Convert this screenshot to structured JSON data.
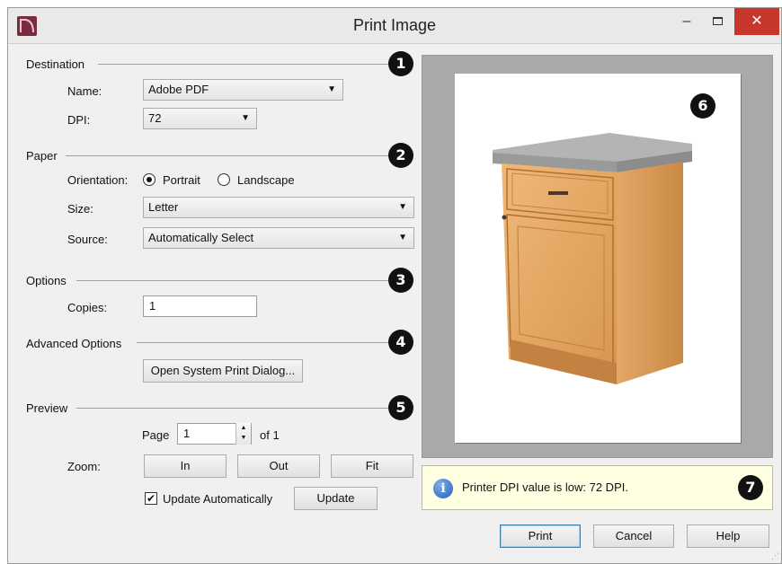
{
  "window": {
    "title": "Print Image",
    "min_glyph": "–",
    "close_glyph": "✕"
  },
  "badges": [
    "1",
    "2",
    "3",
    "4",
    "5",
    "6",
    "7"
  ],
  "destination": {
    "label": "Destination",
    "name_label": "Name:",
    "name_value": "Adobe PDF",
    "dpi_label": "DPI:",
    "dpi_value": "72"
  },
  "paper": {
    "label": "Paper",
    "orientation_label": "Orientation:",
    "portrait": "Portrait",
    "landscape": "Landscape",
    "selected": "Portrait",
    "size_label": "Size:",
    "size_value": "Letter",
    "source_label": "Source:",
    "source_value": "Automatically Select"
  },
  "options": {
    "label": "Options",
    "copies_label": "Copies:",
    "copies_value": "1"
  },
  "advanced": {
    "label": "Advanced Options",
    "system_dialog_button": "Open System Print Dialog..."
  },
  "preview": {
    "label": "Preview",
    "page_label": "Page",
    "page_value": "1",
    "of_label": "of 1",
    "zoom_label": "Zoom:",
    "zoom_in": "In",
    "zoom_out": "Out",
    "zoom_fit": "Fit",
    "update_auto_label": "Update Automatically",
    "update_auto_checked": true,
    "update_button": "Update"
  },
  "info": {
    "message": "Printer DPI value is low: 72 DPI."
  },
  "footer": {
    "print": "Print",
    "cancel": "Cancel",
    "help": "Help"
  },
  "colors": {
    "close": "#c8372b",
    "info_bg": "#ffffe1",
    "preview_bg": "#a9a9a9",
    "badge": "#111111"
  },
  "icons": {
    "app": "chief-architect-logo-icon",
    "info": "info-icon",
    "dropdown": "chevron-down-icon"
  }
}
